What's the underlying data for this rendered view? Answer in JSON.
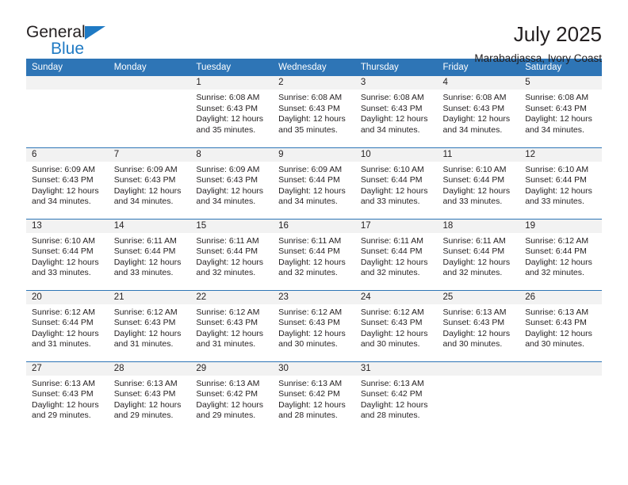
{
  "brand": {
    "line1": "General",
    "line2": "Blue",
    "flag_icon": "triangle-flag-icon",
    "accent_color": "#1f7ac4"
  },
  "header": {
    "title": "July 2025",
    "subtitle": "Marabadjassa, Ivory Coast"
  },
  "theme": {
    "header_blue": "#2e75b6",
    "band_gray": "#f2f2f2",
    "text": "#231f20"
  },
  "weekday_headers": [
    "Sunday",
    "Monday",
    "Tuesday",
    "Wednesday",
    "Thursday",
    "Friday",
    "Saturday"
  ],
  "labels": {
    "sunrise_prefix": "Sunrise: ",
    "sunset_prefix": "Sunset: ",
    "daylight_prefix": "Daylight: "
  },
  "weeks": [
    [
      {
        "day": "",
        "sunrise": "",
        "sunset": "",
        "daylight": "",
        "empty": true
      },
      {
        "day": "",
        "sunrise": "",
        "sunset": "",
        "daylight": "",
        "empty": true
      },
      {
        "day": "1",
        "sunrise": "Sunrise: 6:08 AM",
        "sunset": "Sunset: 6:43 PM",
        "daylight": "Daylight: 12 hours and 35 minutes."
      },
      {
        "day": "2",
        "sunrise": "Sunrise: 6:08 AM",
        "sunset": "Sunset: 6:43 PM",
        "daylight": "Daylight: 12 hours and 35 minutes."
      },
      {
        "day": "3",
        "sunrise": "Sunrise: 6:08 AM",
        "sunset": "Sunset: 6:43 PM",
        "daylight": "Daylight: 12 hours and 34 minutes."
      },
      {
        "day": "4",
        "sunrise": "Sunrise: 6:08 AM",
        "sunset": "Sunset: 6:43 PM",
        "daylight": "Daylight: 12 hours and 34 minutes."
      },
      {
        "day": "5",
        "sunrise": "Sunrise: 6:08 AM",
        "sunset": "Sunset: 6:43 PM",
        "daylight": "Daylight: 12 hours and 34 minutes."
      }
    ],
    [
      {
        "day": "6",
        "sunrise": "Sunrise: 6:09 AM",
        "sunset": "Sunset: 6:43 PM",
        "daylight": "Daylight: 12 hours and 34 minutes."
      },
      {
        "day": "7",
        "sunrise": "Sunrise: 6:09 AM",
        "sunset": "Sunset: 6:43 PM",
        "daylight": "Daylight: 12 hours and 34 minutes."
      },
      {
        "day": "8",
        "sunrise": "Sunrise: 6:09 AM",
        "sunset": "Sunset: 6:43 PM",
        "daylight": "Daylight: 12 hours and 34 minutes."
      },
      {
        "day": "9",
        "sunrise": "Sunrise: 6:09 AM",
        "sunset": "Sunset: 6:44 PM",
        "daylight": "Daylight: 12 hours and 34 minutes."
      },
      {
        "day": "10",
        "sunrise": "Sunrise: 6:10 AM",
        "sunset": "Sunset: 6:44 PM",
        "daylight": "Daylight: 12 hours and 33 minutes."
      },
      {
        "day": "11",
        "sunrise": "Sunrise: 6:10 AM",
        "sunset": "Sunset: 6:44 PM",
        "daylight": "Daylight: 12 hours and 33 minutes."
      },
      {
        "day": "12",
        "sunrise": "Sunrise: 6:10 AM",
        "sunset": "Sunset: 6:44 PM",
        "daylight": "Daylight: 12 hours and 33 minutes."
      }
    ],
    [
      {
        "day": "13",
        "sunrise": "Sunrise: 6:10 AM",
        "sunset": "Sunset: 6:44 PM",
        "daylight": "Daylight: 12 hours and 33 minutes."
      },
      {
        "day": "14",
        "sunrise": "Sunrise: 6:11 AM",
        "sunset": "Sunset: 6:44 PM",
        "daylight": "Daylight: 12 hours and 33 minutes."
      },
      {
        "day": "15",
        "sunrise": "Sunrise: 6:11 AM",
        "sunset": "Sunset: 6:44 PM",
        "daylight": "Daylight: 12 hours and 32 minutes."
      },
      {
        "day": "16",
        "sunrise": "Sunrise: 6:11 AM",
        "sunset": "Sunset: 6:44 PM",
        "daylight": "Daylight: 12 hours and 32 minutes."
      },
      {
        "day": "17",
        "sunrise": "Sunrise: 6:11 AM",
        "sunset": "Sunset: 6:44 PM",
        "daylight": "Daylight: 12 hours and 32 minutes."
      },
      {
        "day": "18",
        "sunrise": "Sunrise: 6:11 AM",
        "sunset": "Sunset: 6:44 PM",
        "daylight": "Daylight: 12 hours and 32 minutes."
      },
      {
        "day": "19",
        "sunrise": "Sunrise: 6:12 AM",
        "sunset": "Sunset: 6:44 PM",
        "daylight": "Daylight: 12 hours and 32 minutes."
      }
    ],
    [
      {
        "day": "20",
        "sunrise": "Sunrise: 6:12 AM",
        "sunset": "Sunset: 6:44 PM",
        "daylight": "Daylight: 12 hours and 31 minutes."
      },
      {
        "day": "21",
        "sunrise": "Sunrise: 6:12 AM",
        "sunset": "Sunset: 6:43 PM",
        "daylight": "Daylight: 12 hours and 31 minutes."
      },
      {
        "day": "22",
        "sunrise": "Sunrise: 6:12 AM",
        "sunset": "Sunset: 6:43 PM",
        "daylight": "Daylight: 12 hours and 31 minutes."
      },
      {
        "day": "23",
        "sunrise": "Sunrise: 6:12 AM",
        "sunset": "Sunset: 6:43 PM",
        "daylight": "Daylight: 12 hours and 30 minutes."
      },
      {
        "day": "24",
        "sunrise": "Sunrise: 6:12 AM",
        "sunset": "Sunset: 6:43 PM",
        "daylight": "Daylight: 12 hours and 30 minutes."
      },
      {
        "day": "25",
        "sunrise": "Sunrise: 6:13 AM",
        "sunset": "Sunset: 6:43 PM",
        "daylight": "Daylight: 12 hours and 30 minutes."
      },
      {
        "day": "26",
        "sunrise": "Sunrise: 6:13 AM",
        "sunset": "Sunset: 6:43 PM",
        "daylight": "Daylight: 12 hours and 30 minutes."
      }
    ],
    [
      {
        "day": "27",
        "sunrise": "Sunrise: 6:13 AM",
        "sunset": "Sunset: 6:43 PM",
        "daylight": "Daylight: 12 hours and 29 minutes."
      },
      {
        "day": "28",
        "sunrise": "Sunrise: 6:13 AM",
        "sunset": "Sunset: 6:43 PM",
        "daylight": "Daylight: 12 hours and 29 minutes."
      },
      {
        "day": "29",
        "sunrise": "Sunrise: 6:13 AM",
        "sunset": "Sunset: 6:42 PM",
        "daylight": "Daylight: 12 hours and 29 minutes."
      },
      {
        "day": "30",
        "sunrise": "Sunrise: 6:13 AM",
        "sunset": "Sunset: 6:42 PM",
        "daylight": "Daylight: 12 hours and 28 minutes."
      },
      {
        "day": "31",
        "sunrise": "Sunrise: 6:13 AM",
        "sunset": "Sunset: 6:42 PM",
        "daylight": "Daylight: 12 hours and 28 minutes."
      },
      {
        "day": "",
        "sunrise": "",
        "sunset": "",
        "daylight": "",
        "empty": true
      },
      {
        "day": "",
        "sunrise": "",
        "sunset": "",
        "daylight": "",
        "empty": true
      }
    ]
  ]
}
